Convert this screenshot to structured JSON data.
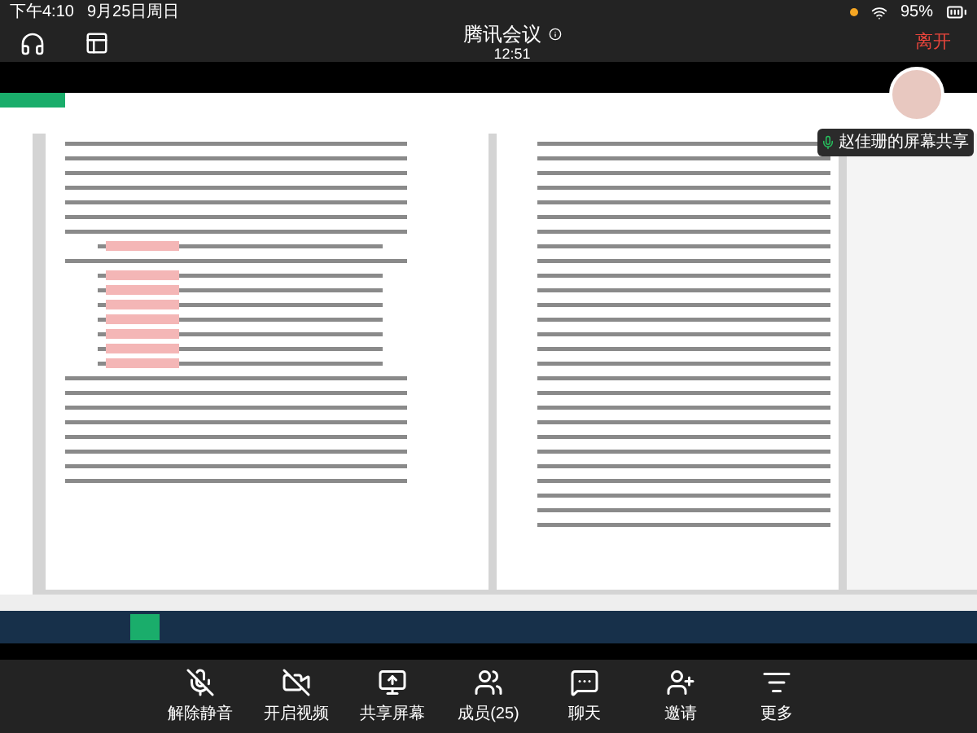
{
  "status_bar": {
    "time": "下午4:10",
    "date": "9月25日周日",
    "battery": "95%"
  },
  "header": {
    "title": "腾讯会议",
    "duration": "12:51",
    "leave": "离开"
  },
  "screen_share": {
    "presenter": "赵佳珊的屏幕共享"
  },
  "toolbar": [
    {
      "kind": "mic",
      "label": "解除静音"
    },
    {
      "kind": "video",
      "label": "开启视频"
    },
    {
      "kind": "share",
      "label": "共享屏幕"
    },
    {
      "kind": "members",
      "label": "成员(25)"
    },
    {
      "kind": "chat",
      "label": "聊天"
    },
    {
      "kind": "invite",
      "label": "邀请"
    },
    {
      "kind": "more",
      "label": "更多"
    }
  ]
}
